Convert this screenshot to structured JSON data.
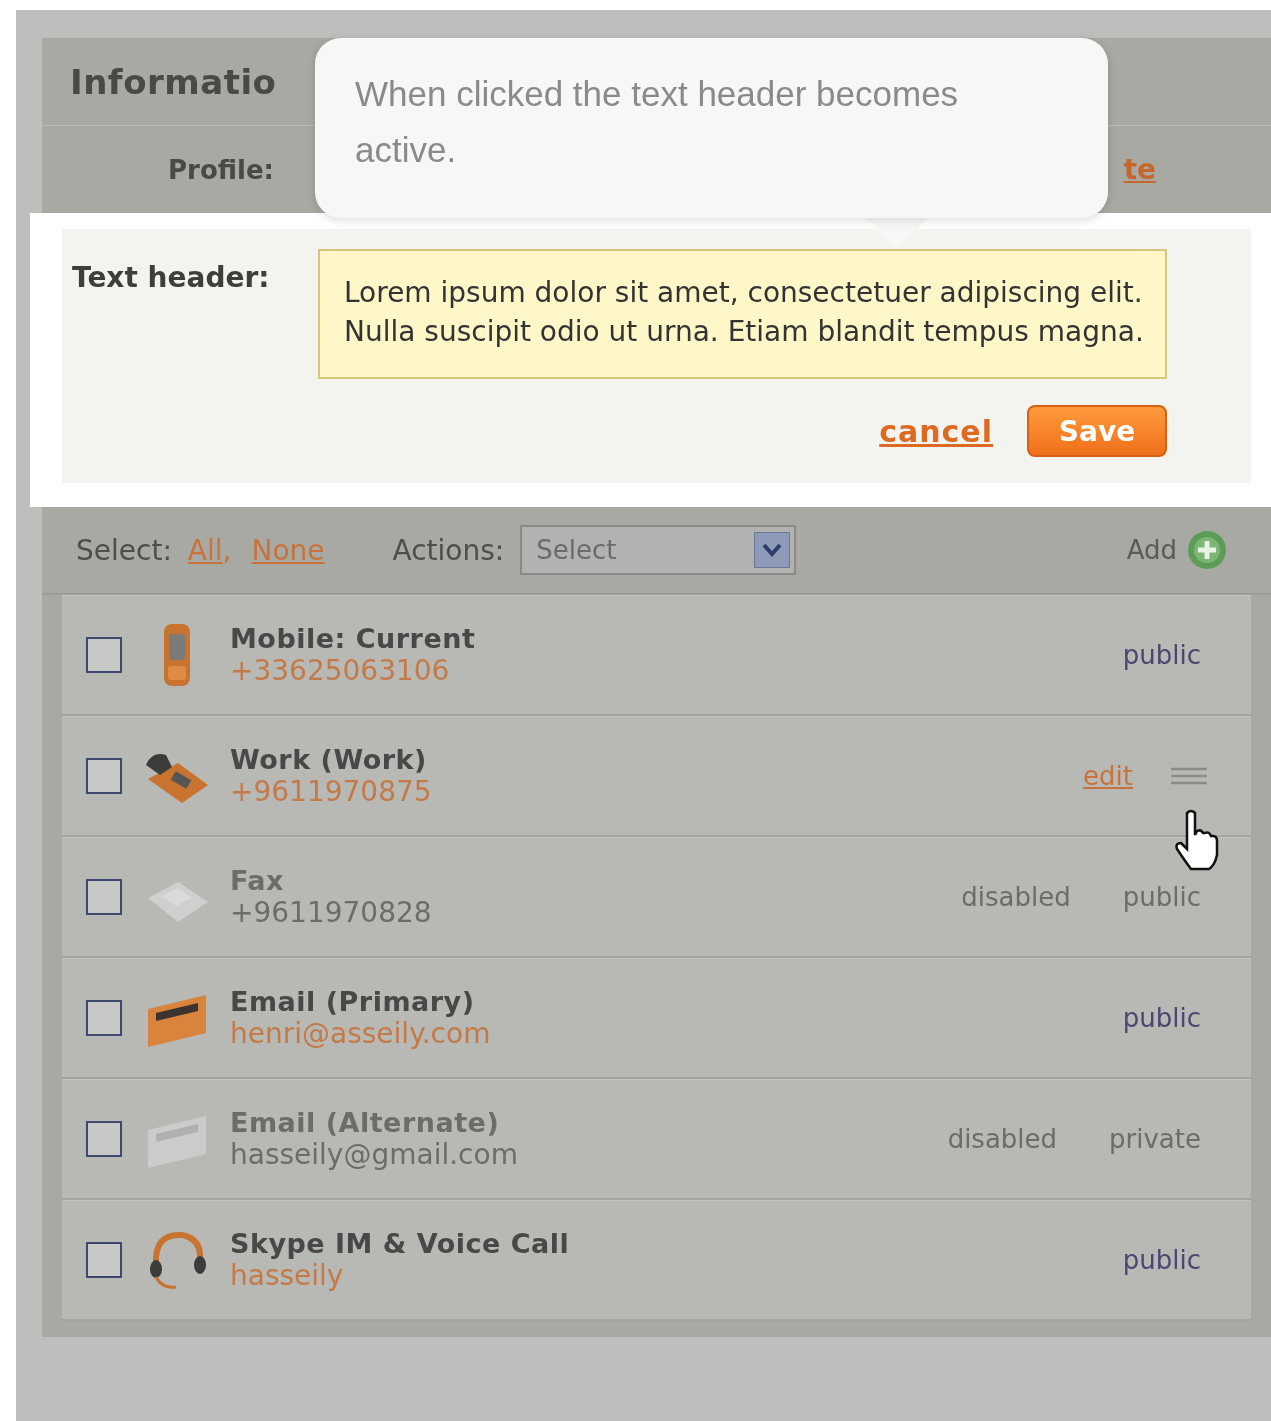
{
  "header": {
    "title": "Informatio"
  },
  "profile": {
    "label": "Profile:",
    "link": "te"
  },
  "tooltip": {
    "text": "When clicked the text header becomes active."
  },
  "editor": {
    "label": "Text header:",
    "value": "Lorem ipsum dolor sit amet, consectetuer adipiscing elit. Nulla suscipit odio ut urna. Etiam blandit tempus magna.",
    "cancel": "cancel",
    "save": "Save"
  },
  "toolbar": {
    "select_label": "Select:",
    "all": "All",
    "separator": ",",
    "none": "None",
    "actions_label": "Actions:",
    "actions_value": "Select",
    "add": "Add"
  },
  "contacts": [
    {
      "kind": "mobile",
      "title": "Mobile: Current",
      "value": "+33625063106",
      "checked": false,
      "disabled": false,
      "hovered": false,
      "visibility": "public"
    },
    {
      "kind": "phone",
      "title": "Work (Work)",
      "value": "+9611970875",
      "checked": false,
      "disabled": false,
      "hovered": true,
      "action": "edit"
    },
    {
      "kind": "fax",
      "title": "Fax",
      "value": "+9611970828",
      "checked": false,
      "disabled": true,
      "hovered": false,
      "status": "disabled",
      "visibility": "public"
    },
    {
      "kind": "inbox",
      "title": "Email (Primary)",
      "value": "henri@asseily.com",
      "checked": false,
      "disabled": false,
      "hovered": false,
      "visibility": "public"
    },
    {
      "kind": "inbox",
      "title": "Email (Alternate)",
      "value": "hasseily@gmail.com",
      "checked": false,
      "disabled": true,
      "hovered": false,
      "status": "disabled",
      "visibility": "private"
    },
    {
      "kind": "headset",
      "title": "Skype IM & Voice Call",
      "value": "hasseily",
      "checked": false,
      "disabled": false,
      "hovered": false,
      "visibility": "public"
    }
  ]
}
